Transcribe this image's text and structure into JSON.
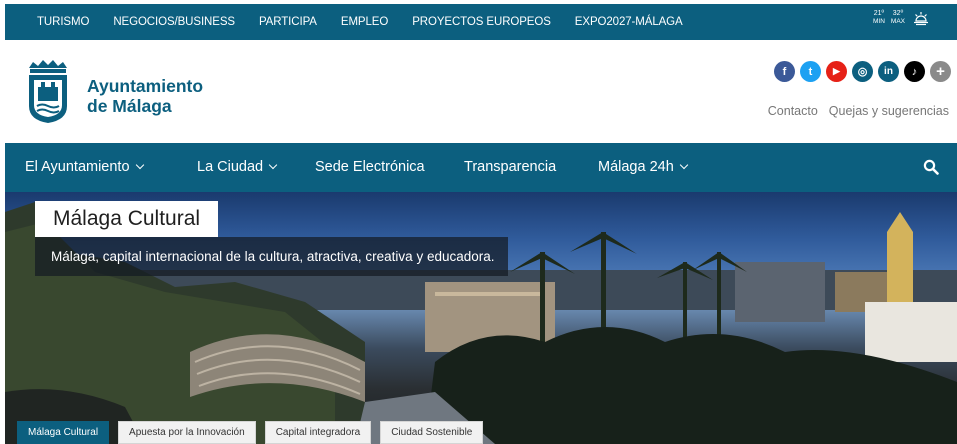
{
  "topbar": {
    "links": [
      "TURISMO",
      "NEGOCIOS/BUSINESS",
      "PARTICIPA",
      "EMPLEO",
      "PROYECTOS EUROPEOS",
      "EXPO2027-MÁLAGA"
    ],
    "weather": {
      "min_value": "21º",
      "min_label": "MIN",
      "max_value": "32º",
      "max_label": "MAX",
      "icon": "sun-icon"
    }
  },
  "header": {
    "logo_line1": "Ayuntamiento",
    "logo_line2": "de Málaga",
    "social": [
      {
        "name": "facebook",
        "glyph": "f",
        "color": "#3b5998"
      },
      {
        "name": "twitter",
        "glyph": "t",
        "color": "#1da1f2"
      },
      {
        "name": "youtube",
        "glyph": "▶",
        "color": "#e62117"
      },
      {
        "name": "instagram",
        "glyph": "◎",
        "color": "#0c5f7f"
      },
      {
        "name": "linkedin",
        "glyph": "in",
        "color": "#0c5f7f"
      },
      {
        "name": "tiktok",
        "glyph": "♪",
        "color": "#000000"
      },
      {
        "name": "more",
        "glyph": "+",
        "color": "#8a8a8a"
      }
    ],
    "contacto": "Contacto",
    "quejas": "Quejas y sugerencias"
  },
  "nav": {
    "items": [
      {
        "label": "El Ayuntamiento",
        "dropdown": true
      },
      {
        "label": "La Ciudad",
        "dropdown": true
      },
      {
        "label": "Sede Electrónica",
        "dropdown": false
      },
      {
        "label": "Transparencia",
        "dropdown": false
      },
      {
        "label": "Málaga 24h",
        "dropdown": true
      }
    ]
  },
  "hero": {
    "title": "Málaga Cultural",
    "subtitle": "Málaga, capital internacional de la cultura, atractiva, creativa y educadora.",
    "tabs": [
      {
        "label": "Málaga Cultural",
        "active": true
      },
      {
        "label": "Apuesta por la Innovación",
        "active": false
      },
      {
        "label": "Capital integradora",
        "active": false
      },
      {
        "label": "Ciudad Sostenible",
        "active": false
      }
    ]
  },
  "colors": {
    "brand": "#0c5f7f",
    "white": "#ffffff",
    "text_muted": "#777777"
  }
}
